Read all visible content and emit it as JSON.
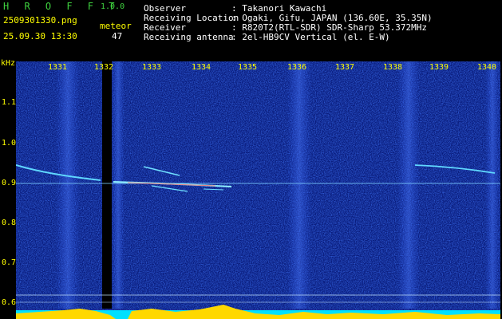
{
  "header": {
    "app_title": "H R O F F T",
    "version": "1.0.0",
    "filename": "2509301330.png",
    "datetime": "25.09.30 13:30",
    "meteor_label": "meteor",
    "meteor_count": "47"
  },
  "info": {
    "observer_label": "Observer",
    "observer_value": ": Takanori Kawachi",
    "location_label": "Receiving Location",
    "location_value": ": Ogaki, Gifu, JAPAN (136.60E, 35.35N)",
    "receiver_label": "Receiver",
    "receiver_value": ": R820T2(RTL-SDR) SDR-Sharp 53.372MHz",
    "antenna_label": "Receiving antenna",
    "antenna_value": ": 2el-HB9CV Vertical (el. E-W)"
  },
  "axes": {
    "y_unit": "kHz",
    "y_ticks": [
      "1.1",
      "1.0",
      "0.9",
      "0.8",
      "0.7",
      "0.6"
    ],
    "x_ticks": [
      "1331",
      "1332",
      "1333",
      "1334",
      "1335",
      "1336",
      "1337",
      "1338",
      "1339",
      "1340"
    ]
  },
  "colors": {
    "background": "#000000",
    "waterfall": "#0a1f8c",
    "header_title": "#3fd23f",
    "label_yellow": "#ffff00",
    "level_bar": "#00e0ff",
    "level_peaks": "#ffd800",
    "echo_line": "#6fc8ff"
  }
}
